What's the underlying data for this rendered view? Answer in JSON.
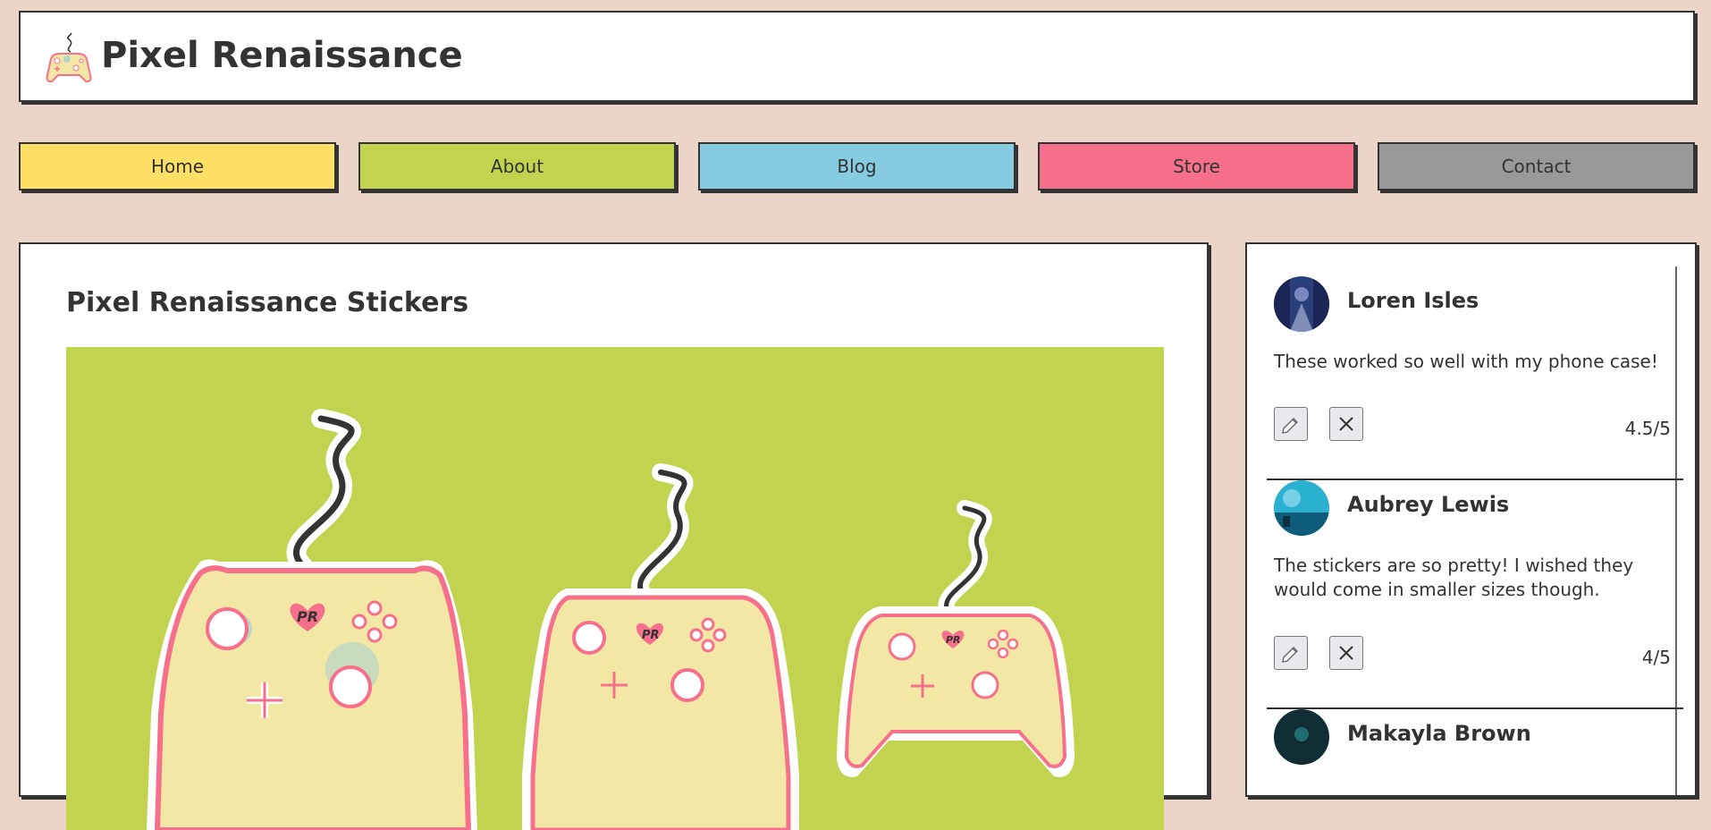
{
  "site": {
    "title": "Pixel Renaissance",
    "logo_icon": "gamepad-icon"
  },
  "nav": [
    {
      "label": "Home",
      "color": "#ffdf66"
    },
    {
      "label": "About",
      "color": "#c2d44f"
    },
    {
      "label": "Blog",
      "color": "#87cbe2"
    },
    {
      "label": "Store",
      "color": "#f7708b"
    },
    {
      "label": "Contact",
      "color": "#999999"
    }
  ],
  "post": {
    "title": "Pixel Renaissance Stickers",
    "image_background": "#c2d44f"
  },
  "reviews": [
    {
      "name": "Loren Isles",
      "text": "These worked so well with my phone case!",
      "rating": "4.5/5",
      "edit_icon": "pencil-icon",
      "delete_icon": "close-icon"
    },
    {
      "name": "Aubrey Lewis",
      "text": "The stickers are so pretty! I wished they would come in smaller sizes though.",
      "rating": "4/5",
      "edit_icon": "pencil-icon",
      "delete_icon": "close-icon"
    },
    {
      "name": "Makayla Brown"
    }
  ]
}
